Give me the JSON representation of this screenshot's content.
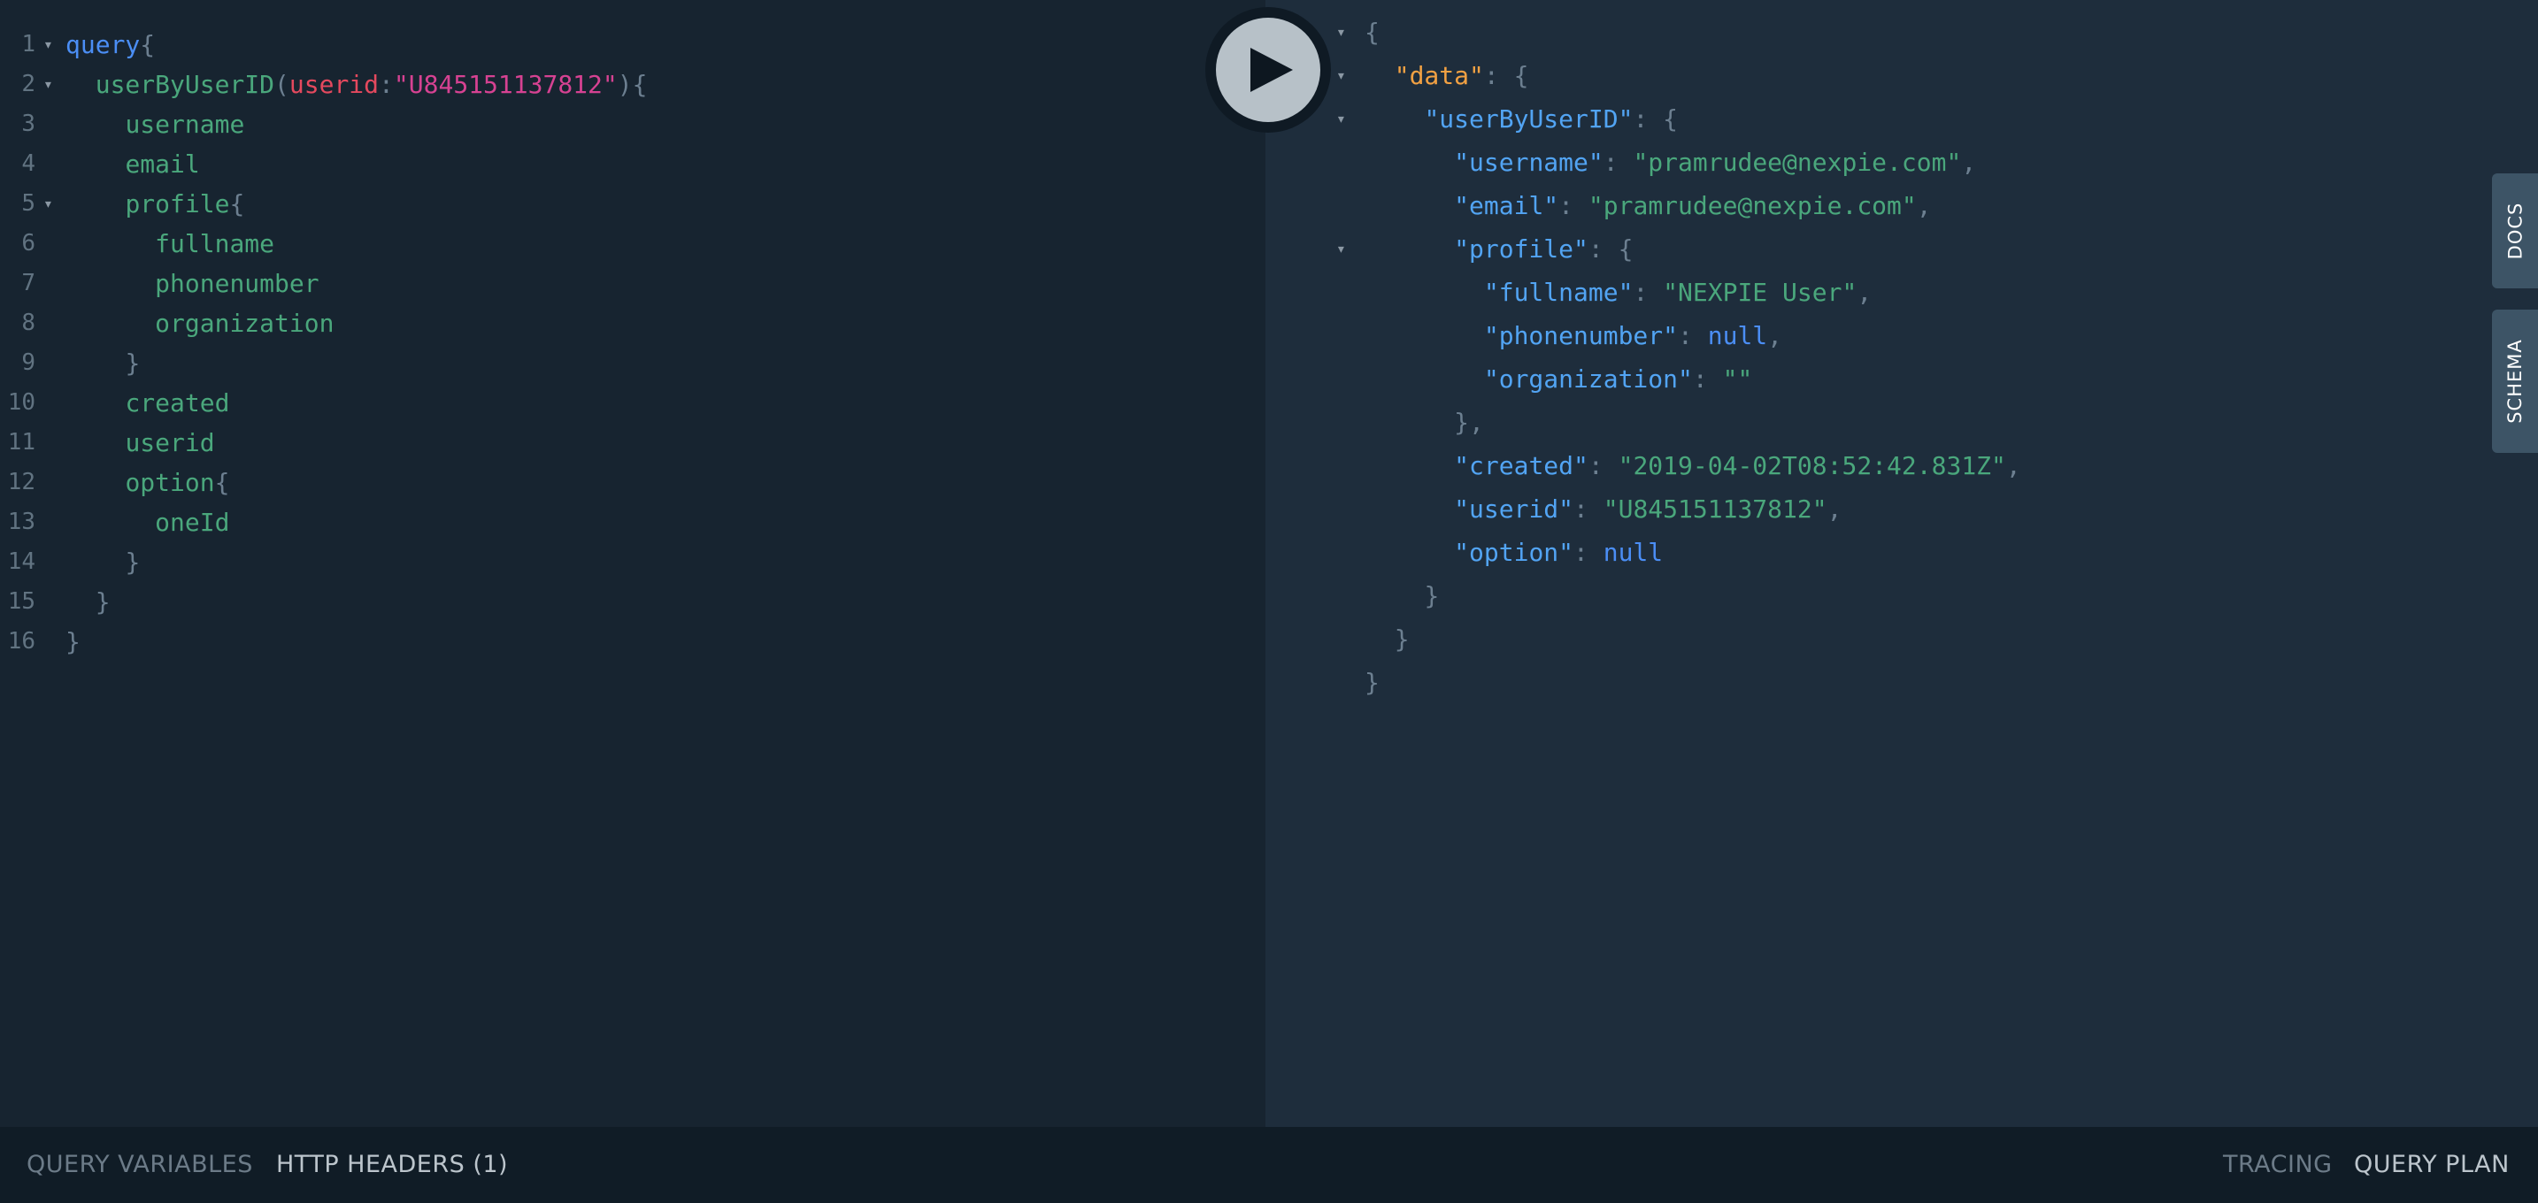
{
  "editor": {
    "lines": [
      {
        "n": "1",
        "fold": true,
        "indent": "",
        "parts": [
          {
            "c": "kw",
            "t": "query"
          },
          {
            "c": "punc",
            "t": "{"
          }
        ]
      },
      {
        "n": "2",
        "fold": true,
        "indent": "  ",
        "parts": [
          {
            "c": "field",
            "t": "userByUserID"
          },
          {
            "c": "punc",
            "t": "("
          },
          {
            "c": "arg",
            "t": "userid"
          },
          {
            "c": "punc",
            "t": ":"
          },
          {
            "c": "str",
            "t": "\"U845151137812\""
          },
          {
            "c": "punc",
            "t": "){"
          }
        ]
      },
      {
        "n": "3",
        "fold": false,
        "indent": "    ",
        "parts": [
          {
            "c": "field",
            "t": "username"
          }
        ]
      },
      {
        "n": "4",
        "fold": false,
        "indent": "    ",
        "parts": [
          {
            "c": "field",
            "t": "email"
          }
        ]
      },
      {
        "n": "5",
        "fold": true,
        "indent": "    ",
        "parts": [
          {
            "c": "field",
            "t": "profile"
          },
          {
            "c": "punc",
            "t": "{"
          }
        ]
      },
      {
        "n": "6",
        "fold": false,
        "indent": "      ",
        "parts": [
          {
            "c": "field",
            "t": "fullname"
          }
        ]
      },
      {
        "n": "7",
        "fold": false,
        "indent": "      ",
        "parts": [
          {
            "c": "field",
            "t": "phonenumber"
          }
        ]
      },
      {
        "n": "8",
        "fold": false,
        "indent": "      ",
        "parts": [
          {
            "c": "field",
            "t": "organization"
          }
        ]
      },
      {
        "n": "9",
        "fold": false,
        "indent": "    ",
        "parts": [
          {
            "c": "punc",
            "t": "}"
          }
        ]
      },
      {
        "n": "10",
        "fold": false,
        "indent": "    ",
        "parts": [
          {
            "c": "field",
            "t": "created"
          }
        ]
      },
      {
        "n": "11",
        "fold": false,
        "indent": "    ",
        "parts": [
          {
            "c": "field",
            "t": "userid"
          }
        ]
      },
      {
        "n": "12",
        "fold": false,
        "indent": "    ",
        "parts": [
          {
            "c": "field",
            "t": "option"
          },
          {
            "c": "punc",
            "t": "{"
          }
        ]
      },
      {
        "n": "13",
        "fold": false,
        "indent": "      ",
        "parts": [
          {
            "c": "field",
            "t": "oneId"
          }
        ]
      },
      {
        "n": "14",
        "fold": false,
        "indent": "    ",
        "parts": [
          {
            "c": "punc",
            "t": "}"
          }
        ]
      },
      {
        "n": "15",
        "fold": false,
        "indent": "  ",
        "parts": [
          {
            "c": "punc",
            "t": "}"
          }
        ]
      },
      {
        "n": "16",
        "fold": false,
        "indent": "",
        "parts": [
          {
            "c": "punc",
            "t": "}"
          }
        ]
      }
    ]
  },
  "result": {
    "lines": [
      {
        "fold": true,
        "indent": "",
        "parts": [
          {
            "c": "punc",
            "t": "{"
          }
        ]
      },
      {
        "fold": true,
        "indent": "  ",
        "parts": [
          {
            "c": "datakey",
            "t": "\"data\""
          },
          {
            "c": "punc",
            "t": ": {"
          }
        ]
      },
      {
        "fold": true,
        "indent": "    ",
        "parts": [
          {
            "c": "key",
            "t": "\"userByUserID\""
          },
          {
            "c": "punc",
            "t": ": {"
          }
        ]
      },
      {
        "fold": false,
        "indent": "      ",
        "parts": [
          {
            "c": "key",
            "t": "\"username\""
          },
          {
            "c": "punc",
            "t": ": "
          },
          {
            "c": "strval",
            "t": "\"pramrudee@nexpie.com\""
          },
          {
            "c": "punc",
            "t": ","
          }
        ]
      },
      {
        "fold": false,
        "indent": "      ",
        "parts": [
          {
            "c": "key",
            "t": "\"email\""
          },
          {
            "c": "punc",
            "t": ": "
          },
          {
            "c": "strval",
            "t": "\"pramrudee@nexpie.com\""
          },
          {
            "c": "punc",
            "t": ","
          }
        ]
      },
      {
        "fold": true,
        "indent": "      ",
        "parts": [
          {
            "c": "key",
            "t": "\"profile\""
          },
          {
            "c": "punc",
            "t": ": {"
          }
        ]
      },
      {
        "fold": false,
        "indent": "        ",
        "parts": [
          {
            "c": "key",
            "t": "\"fullname\""
          },
          {
            "c": "punc",
            "t": ": "
          },
          {
            "c": "strval",
            "t": "\"NEXPIE User\""
          },
          {
            "c": "punc",
            "t": ","
          }
        ]
      },
      {
        "fold": false,
        "indent": "        ",
        "parts": [
          {
            "c": "key",
            "t": "\"phonenumber\""
          },
          {
            "c": "punc",
            "t": ": "
          },
          {
            "c": "nullval",
            "t": "null"
          },
          {
            "c": "punc",
            "t": ","
          }
        ]
      },
      {
        "fold": false,
        "indent": "        ",
        "parts": [
          {
            "c": "key",
            "t": "\"organization\""
          },
          {
            "c": "punc",
            "t": ": "
          },
          {
            "c": "strval",
            "t": "\"\""
          }
        ]
      },
      {
        "fold": false,
        "indent": "      ",
        "parts": [
          {
            "c": "punc",
            "t": "},"
          }
        ]
      },
      {
        "fold": false,
        "indent": "      ",
        "parts": [
          {
            "c": "key",
            "t": "\"created\""
          },
          {
            "c": "punc",
            "t": ": "
          },
          {
            "c": "strval",
            "t": "\"2019-04-02T08:52:42.831Z\""
          },
          {
            "c": "punc",
            "t": ","
          }
        ]
      },
      {
        "fold": false,
        "indent": "      ",
        "parts": [
          {
            "c": "key",
            "t": "\"userid\""
          },
          {
            "c": "punc",
            "t": ": "
          },
          {
            "c": "strval",
            "t": "\"U845151137812\""
          },
          {
            "c": "punc",
            "t": ","
          }
        ]
      },
      {
        "fold": false,
        "indent": "      ",
        "parts": [
          {
            "c": "key",
            "t": "\"option\""
          },
          {
            "c": "punc",
            "t": ": "
          },
          {
            "c": "nullval",
            "t": "null"
          }
        ]
      },
      {
        "fold": false,
        "indent": "    ",
        "parts": [
          {
            "c": "punc",
            "t": "}"
          }
        ]
      },
      {
        "fold": false,
        "indent": "  ",
        "parts": [
          {
            "c": "punc",
            "t": "}"
          }
        ]
      },
      {
        "fold": false,
        "indent": "",
        "parts": [
          {
            "c": "punc",
            "t": "}"
          }
        ]
      }
    ]
  },
  "run_button": {
    "icon": "play-icon"
  },
  "side_tabs": {
    "docs": "DOCS",
    "schema": "SCHEMA"
  },
  "bottom_bar": {
    "query_variables": "QUERY VARIABLES",
    "http_headers": "HTTP HEADERS (1)",
    "tracing": "TRACING",
    "query_plan": "QUERY PLAN"
  },
  "fold_glyph": "▾",
  "colors": {
    "editor_bg": "#172430",
    "result_bg": "#1e2d3c",
    "keyword": "#4b8ef5",
    "field": "#4aa77c",
    "argument": "#e4495e",
    "string": "#d64292",
    "json_key": "#52a4f3",
    "data_key": "#f2a143"
  }
}
